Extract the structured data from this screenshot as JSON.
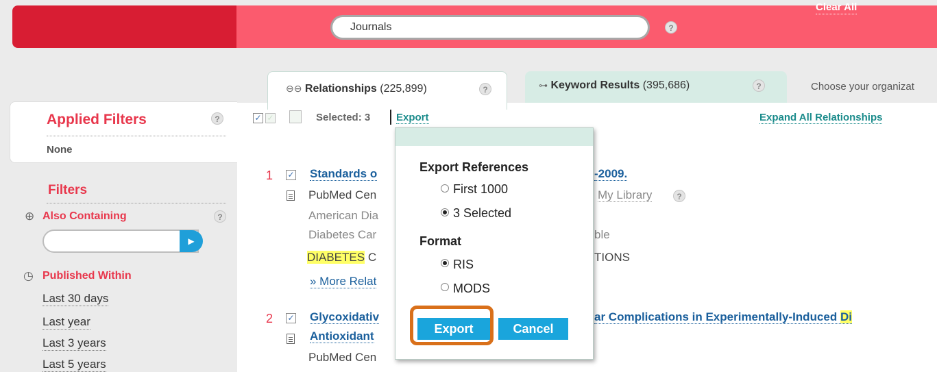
{
  "header": {
    "clear_all": "Clear All",
    "search_value": "Journals",
    "help": "?"
  },
  "tabs": [
    {
      "label": "Relationships",
      "count": "(225,899)"
    },
    {
      "label": "Keyword Results",
      "count": "(395,686)"
    }
  ],
  "org_text": "Choose your organizat",
  "toolbar": {
    "selected": "Selected: 3",
    "export": "Export",
    "expand_all": "Expand All Relationships"
  },
  "sidebar": {
    "applied_filters": "Applied Filters",
    "applied_none": "None",
    "filters": "Filters",
    "also_containing": "Also Containing",
    "published_within": "Published Within",
    "periods": [
      "Last 30 days",
      "Last year",
      "Last 3 years",
      "Last 5 years"
    ]
  },
  "results": [
    {
      "num": "1",
      "title_start": "Standards o",
      "title_end": "-2009.",
      "source": "PubMed Cen",
      "my_library": "My Library",
      "authors": "American Dia",
      "journal": "Diabetes Car",
      "journal_end": "ble",
      "keyword": "DIABETES",
      "keyword_rest": " C",
      "keyword_end": "TIONS",
      "more": "» More Relat"
    },
    {
      "num": "2",
      "title_start": "Glycoxidativ",
      "title_end": "ar Complications in Experimentally-Induced",
      "title_hl": "Di",
      "title_line2": "Antioxidant",
      "source": "PubMed Cen"
    }
  ],
  "popup": {
    "heading": "Export References",
    "range_options": [
      "First 1000",
      "3 Selected"
    ],
    "range_selected": "3 Selected",
    "format_heading": "Format",
    "format_options": [
      "RIS",
      "MODS"
    ],
    "format_selected": "RIS",
    "export_button": "Export",
    "cancel_button": "Cancel"
  },
  "colors": {
    "brand_red": "#d81d33",
    "band_pink": "#fb5b6e",
    "link_teal": "#1a8b8b",
    "button_blue": "#1aa5dc",
    "highlight_orange": "#d9701a"
  }
}
